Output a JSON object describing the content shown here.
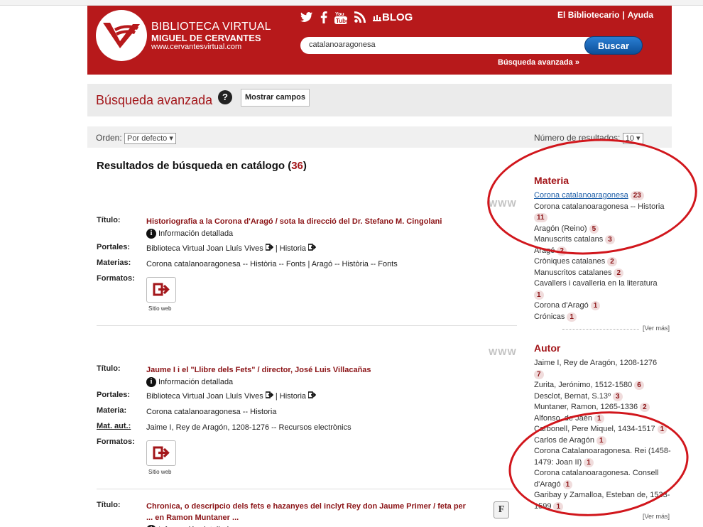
{
  "header": {
    "brand_line1": "BIBLIOTECA VIRTUAL",
    "brand_line2": "MIGUEL DE CERVANTES",
    "brand_line3": "www.cervantesvirtual.com",
    "blog": "BLOG",
    "link_bibliotecario": "El Bibliotecario",
    "separator": "|",
    "link_ayuda": "Ayuda",
    "search_value": "catalanoaragonesa",
    "search_button": "Buscar",
    "advanced_link": "Búsqueda avanzada »",
    "accent_color": "#b7191b",
    "social_icons": [
      "twitter-icon",
      "facebook-icon",
      "youtube-icon",
      "rss-icon",
      "blog-icon"
    ]
  },
  "titlebar": {
    "title": "Búsqueda avanzada",
    "help": "?",
    "show_fields": "Mostrar campos"
  },
  "sortbar": {
    "order_label": "Orden:",
    "order_value": "Por defecto ▾",
    "count_label": "Número de resultados:",
    "count_value": "10  ▾"
  },
  "results": {
    "heading_prefix": "Resultados de búsqueda en catálogo (",
    "count": "36",
    "heading_suffix": ")",
    "www": "WWW",
    "info_label": "Información detallada",
    "format_label": "Sitio web",
    "items": [
      {
        "titulo_label": "Título:",
        "titulo": "Historiografia a la Corona d'Aragó / sota la direcció del Dr. Stefano M. Cingolani",
        "portales_label": "Portales:",
        "portal1": "Biblioteca Virtual Joan Lluís Vives",
        "portal_sep": " | ",
        "portal2": "Historia",
        "materias_label": "Materias:",
        "materias": "Corona catalanoaragonesa -- Història -- Fonts | Aragó -- Història -- Fonts",
        "formatos_label": "Formatos:"
      },
      {
        "titulo_label": "Título:",
        "titulo": "Jaume I i el \"Llibre dels Fets\" / director, José Luis Villacañas",
        "portales_label": "Portales:",
        "portal1": "Biblioteca Virtual Joan Lluís Vives",
        "portal_sep": " | ",
        "portal2": "Historia",
        "materia_label": "Materia:",
        "materia": "Corona catalanoaragonesa -- Historia",
        "matautor_label": "Mat. aut.:",
        "matautor": "Jaime I, Rey de Aragón, 1208-1276 -- Recursos electrònics",
        "formatos_label": "Formatos:"
      },
      {
        "titulo_label": "Título:",
        "titulo_line1": "Chronica, o descripcio dels fets e hazanyes del inclyt Rey don Jaume Primer / feta per",
        "titulo_line2": "... en Ramon Muntaner ...",
        "icon_letter": "F"
      }
    ]
  },
  "facets": {
    "vermas": "[Ver más]",
    "materia": {
      "title": "Materia",
      "items": [
        {
          "label": "Corona catalanoaragonesa",
          "count": "23"
        },
        {
          "label": "Corona catalanoaragonesa -- Historia",
          "count": "11"
        },
        {
          "label": "Aragón (Reino)",
          "count": "5"
        },
        {
          "label": "Manuscrits catalans",
          "count": "3"
        },
        {
          "label": "Aragó",
          "count": "2"
        },
        {
          "label": "Cròniques catalanes",
          "count": "2"
        },
        {
          "label": "Manuscritos catalanes",
          "count": "2"
        },
        {
          "label": "Cavallers i cavalleria en la literatura",
          "count": "1"
        },
        {
          "label": "Corona d'Aragó",
          "count": "1"
        },
        {
          "label": "Crónicas",
          "count": "1"
        }
      ]
    },
    "autor": {
      "title": "Autor",
      "items": [
        {
          "label": "Jaime I, Rey de Aragón, 1208-1276",
          "count": "7"
        },
        {
          "label": "Zurita, Jerónimo, 1512-1580",
          "count": "6"
        },
        {
          "label": "Desclot, Bernat, S.13º",
          "count": "3"
        },
        {
          "label": "Muntaner, Ramon, 1265-1336",
          "count": "2"
        },
        {
          "label": "Alfonso, de Jaén",
          "count": "1"
        },
        {
          "label": "Carbonell, Pere Miquel, 1434-1517",
          "count": "1"
        },
        {
          "label": "Carlos de Aragón",
          "count": "1"
        },
        {
          "label": "Corona Catalanoaragonesa. Rei (1458-1479: Joan II)",
          "count": "1"
        },
        {
          "label": "Corona catalanoaragonesa. Consell d'Aragó",
          "count": "1"
        },
        {
          "label": "Garibay y Zamalloa, Esteban de, 1533-1599",
          "count": "1"
        }
      ]
    }
  }
}
